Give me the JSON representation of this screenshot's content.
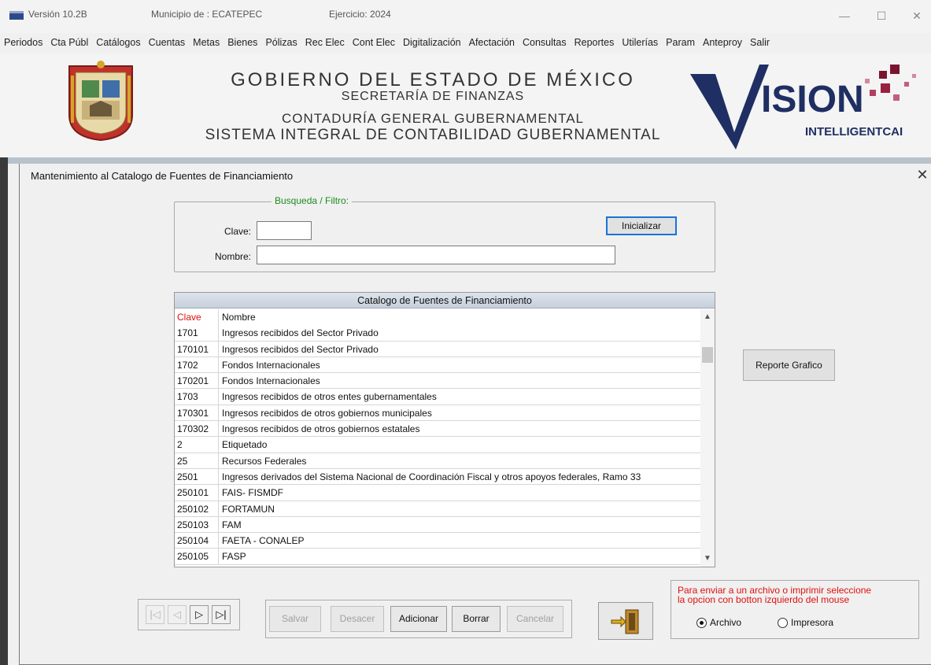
{
  "titlebar": {
    "version": "Versión 10.2B",
    "municipio": "Municipio de : ECATEPEC",
    "ejercicio": "Ejercicio: 2024",
    "minimize": "—",
    "maximize": "☐",
    "close": "✕"
  },
  "menu": [
    "Periodos",
    "Cta Públ",
    "Catálogos",
    "Cuentas",
    "Metas",
    "Bienes",
    "Pólizas",
    "Rec Elec",
    "Cont Elec",
    "Digitalización",
    "Afectación",
    "Consultas",
    "Reportes",
    "Utilerías",
    "Param",
    "Anteproy",
    "Salir"
  ],
  "banner": {
    "line1": "GOBIERNO DEL ESTADO DE MÉXICO",
    "line2": "SECRETARÍA DE FINANZAS",
    "line3": "CONTADURÍA GENERAL GUBERNAMENTAL",
    "line4": "SISTEMA INTEGRAL DE CONTABILIDAD GUBERNAMENTAL",
    "logo_text_1": "ISION",
    "logo_text_2": "INTELLIGENTCAI"
  },
  "dialog": {
    "title": "Mantenimiento al Catalogo de Fuentes de Financiamiento",
    "close": "✕"
  },
  "search": {
    "legend": "Busqueda / Filtro:",
    "clave_label": "Clave:",
    "clave_value": "",
    "nombre_label": "Nombre:",
    "nombre_value": "",
    "reset_button": "Inicializar"
  },
  "grid": {
    "title": "Catalogo de Fuentes de Financiamiento",
    "col_clave": "Clave",
    "col_nombre": "Nombre",
    "rows": [
      [
        "1701",
        "Ingresos recibidos del Sector Privado"
      ],
      [
        "170101",
        "Ingresos recibidos del Sector Privado"
      ],
      [
        "1702",
        "Fondos Internacionales"
      ],
      [
        "170201",
        "Fondos Internacionales"
      ],
      [
        "1703",
        "Ingresos recibidos de otros entes gubernamentales"
      ],
      [
        "170301",
        "Ingresos recibidos de otros gobiernos municipales"
      ],
      [
        "170302",
        "Ingresos recibidos de otros gobiernos estatales"
      ],
      [
        "2",
        "Etiquetado"
      ],
      [
        "25",
        "Recursos Federales"
      ],
      [
        "2501",
        "Ingresos derivados del Sistema Nacional de Coordinación Fiscal y otros apoyos federales, Ramo 33"
      ],
      [
        "250101",
        "FAIS- FISMDF"
      ],
      [
        "250102",
        "FORTAMUN"
      ],
      [
        "250103",
        "FAM"
      ],
      [
        "250104",
        "FAETA  - CONALEP"
      ],
      [
        "250105",
        "FASP"
      ]
    ],
    "scroll_up": "▲",
    "scroll_down": "▼"
  },
  "report_button": "Reporte Grafico",
  "nav": {
    "first": "|◁",
    "prev": "◁",
    "next": "▷",
    "last": "▷|"
  },
  "actions": {
    "save": "Salvar",
    "undo": "Desacer",
    "add": "Adicionar",
    "delete": "Borrar",
    "cancel": "Cancelar"
  },
  "print": {
    "message_line1": "Para enviar a un archivo o imprimir seleccione",
    "message_line2": "la opcion con botton izquierdo del mouse",
    "option_file": "Archivo",
    "option_printer": "Impresora",
    "selected": "Archivo"
  }
}
